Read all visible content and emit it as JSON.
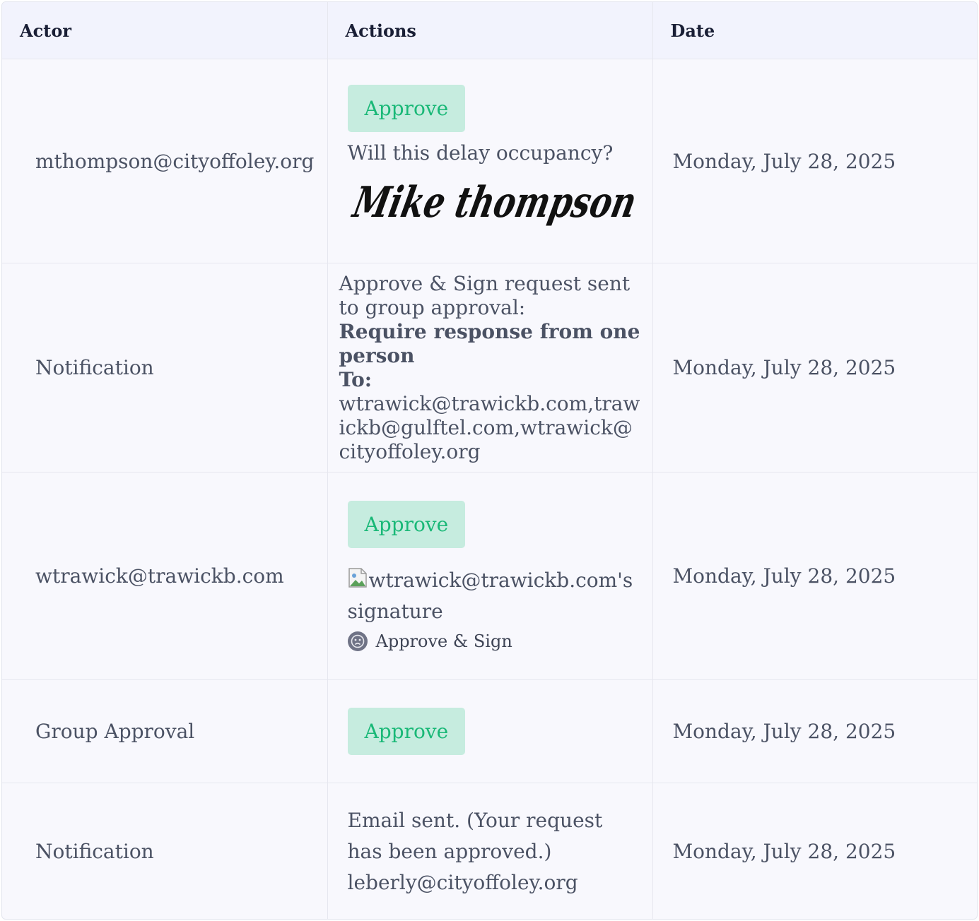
{
  "table": {
    "headers": {
      "actor": "Actor",
      "actions": "Actions",
      "date": "Date"
    },
    "rows": [
      {
        "actor": "mthompson@cityoffoley.org",
        "approve_label": "Approve",
        "comment": "Will this delay occupancy?",
        "signature_text": "Mike thompson",
        "date": "Monday, July 28, 2025"
      },
      {
        "actor": "Notification",
        "line1": "Approve & Sign request sent to group approval:",
        "bold_line": "Require response from one person",
        "to_label": "To:",
        "emails": "wtrawick@trawickb.com,trawickb@gulftel.com,wtrawick@cityoffoley.org",
        "date": "Monday, July 28, 2025"
      },
      {
        "actor": "wtrawick@trawickb.com",
        "approve_label": "Approve",
        "signature_alt": "wtrawick@trawickb.com's signature",
        "method_label": "Approve & Sign",
        "date": "Monday, July 28, 2025"
      },
      {
        "actor": "Group Approval",
        "approve_label": "Approve",
        "date": "Monday, July 28, 2025"
      },
      {
        "actor": "Notification",
        "email_line1": "Email sent. (Your request has been approved.)",
        "email_line2": "leberly@cityoffoley.org",
        "date": "Monday, July 28, 2025"
      }
    ]
  },
  "colors": {
    "approve_bg": "#c6ecdf",
    "approve_text": "#19b877",
    "header_bg": "#f2f3fd",
    "row_bg": "#f8f8fd"
  },
  "icons": {
    "broken_image": "broken-image-icon",
    "method": "sad-face-icon"
  }
}
